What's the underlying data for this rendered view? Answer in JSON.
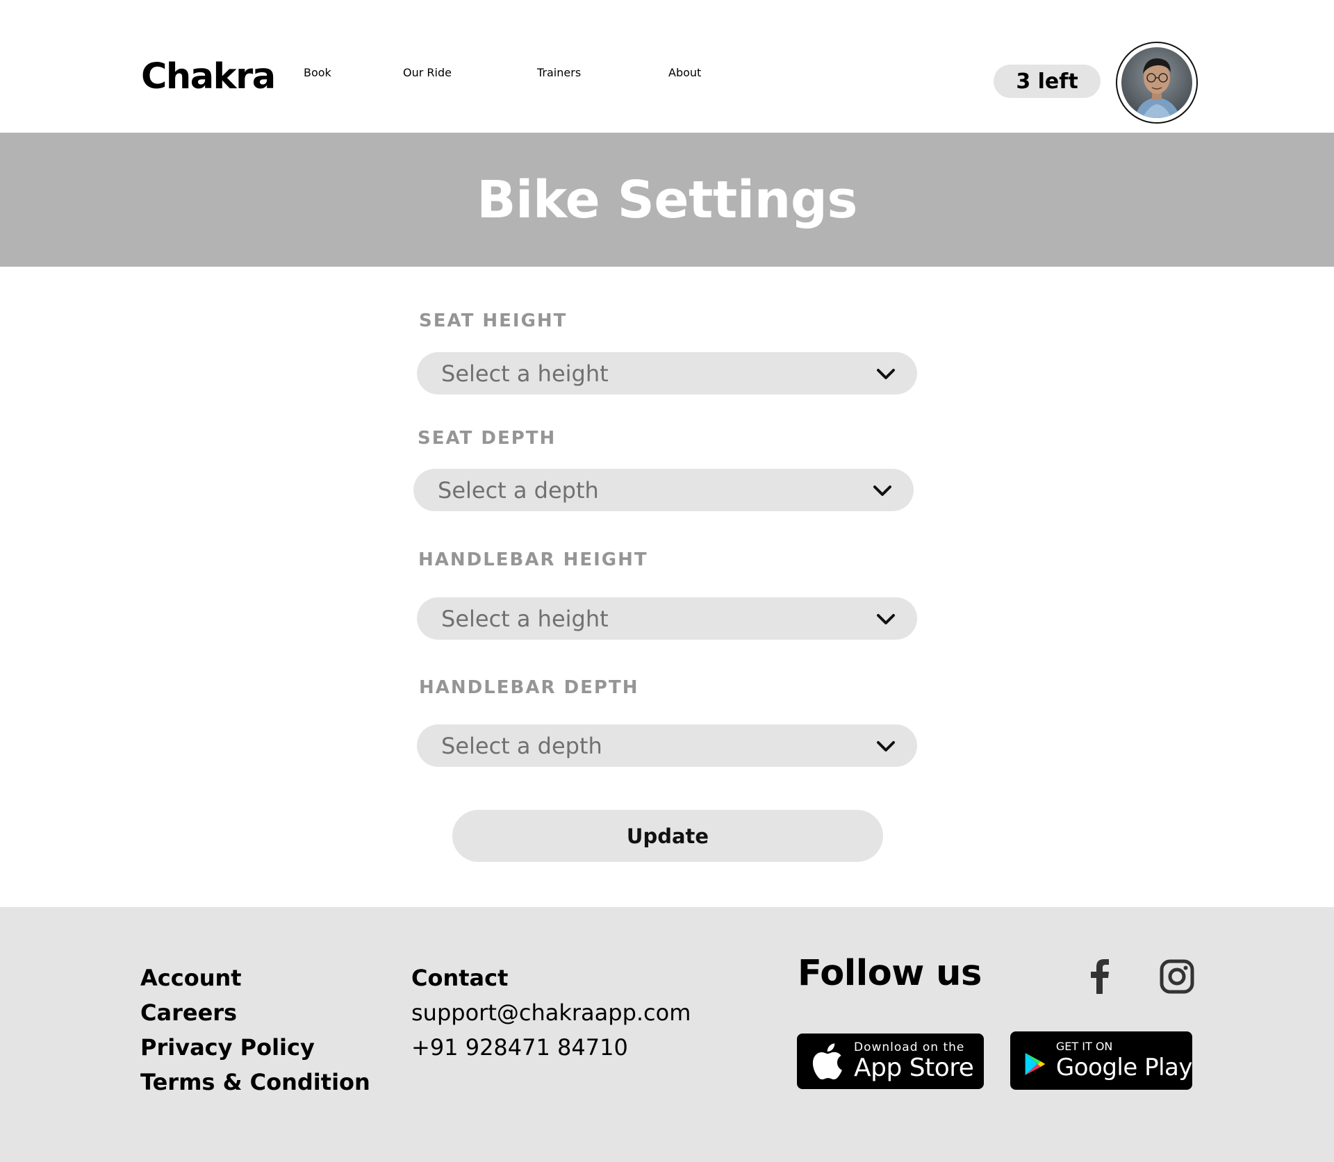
{
  "header": {
    "logo": "Chakra",
    "nav": [
      "Book",
      "Our Ride",
      "Trainers",
      "About"
    ],
    "credits": "3 left"
  },
  "banner": {
    "title": "Bike Settings"
  },
  "form": {
    "fields": [
      {
        "label": "SEAT HEIGHT",
        "value": "Select a height"
      },
      {
        "label": "SEAT DEPTH",
        "value": "Select a depth"
      },
      {
        "label": "HANDLEBAR HEIGHT",
        "value": "Select a height"
      },
      {
        "label": "HANDLEBAR DEPTH",
        "value": "Select a depth"
      }
    ],
    "submit": "Update"
  },
  "footer": {
    "links": [
      "Account",
      "Careers",
      "Privacy Policy",
      "Terms & Condition"
    ],
    "contact": {
      "heading": "Contact",
      "email": "support@chakraapp.com",
      "phone": "+91 928471 84710"
    },
    "follow": "Follow us",
    "social_icons": [
      "facebook-icon",
      "instagram-icon"
    ],
    "app_store": {
      "small": "Download on the",
      "big": "App Store"
    },
    "google_play": {
      "small": "GET IT ON",
      "big": "Google Play"
    }
  },
  "colors": {
    "banner_bg": "#b3b3b3",
    "field_bg": "#e4e4e4",
    "footer_bg": "#e4e4e4",
    "nav_text": "#a9a9a9",
    "label_text": "#959595"
  }
}
